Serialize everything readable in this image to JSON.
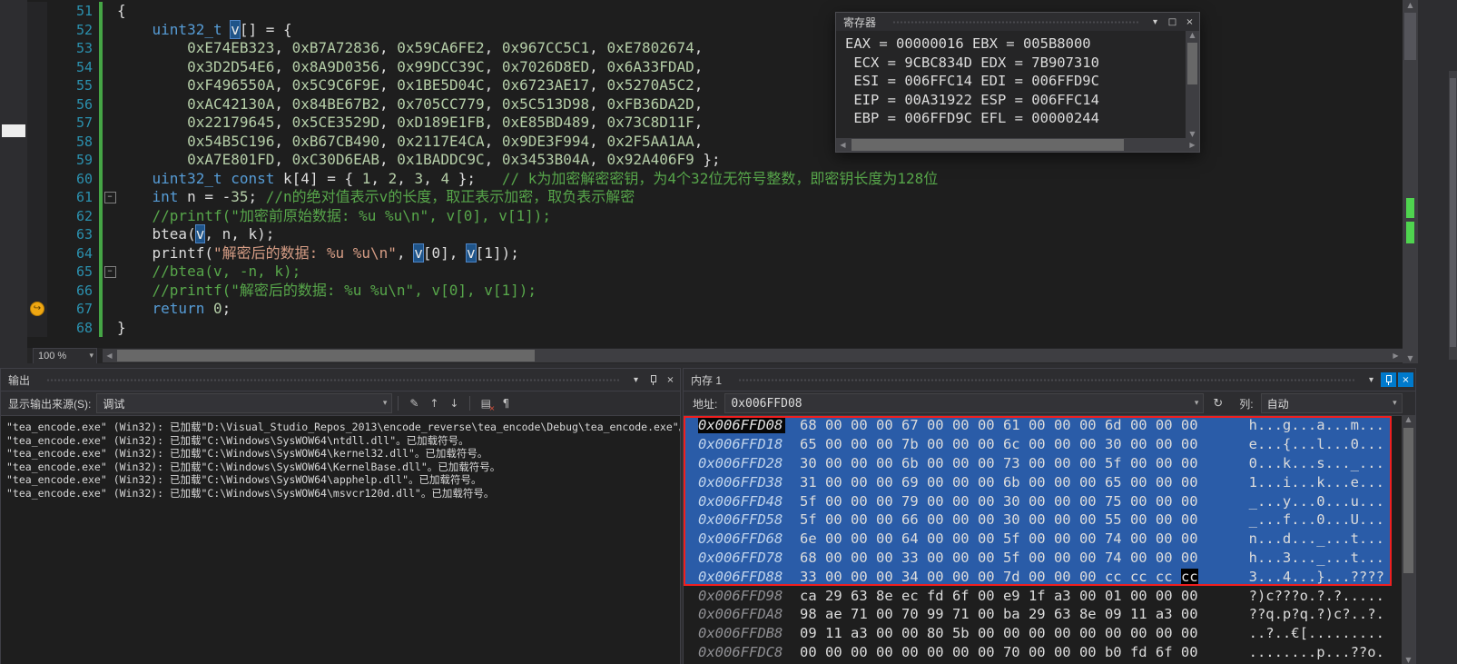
{
  "colors": {
    "selection_blue": "#2A5CA8",
    "annotation_border_red": "#F01F1F",
    "accent_blue": "#007ACC",
    "change_tracking_green": "#45A545",
    "keyword": "#569CD6",
    "number": "#B5CEA8",
    "comment": "#57A64A",
    "string": "#D69D85"
  },
  "icons": {
    "window_menu": "▾",
    "dropdown": "▾",
    "maximize": "□",
    "close": "×",
    "refresh": "↻",
    "scroll_up": "▲",
    "scroll_down": "▼",
    "scroll_left": "◀",
    "scroll_right": "▶",
    "fold_collapse": "−",
    "current_statement": "↪",
    "find_message": "✎",
    "prev_message": "↑",
    "next_message": "↓",
    "clear_all": "▤",
    "word_wrap": "¶"
  },
  "editor": {
    "zoom_level": "100 %",
    "lines": [
      {
        "n": "51",
        "seg": [
          [
            "p",
            "{"
          ]
        ]
      },
      {
        "n": "52",
        "seg": [
          [
            "p",
            "    "
          ],
          [
            "k",
            "uint32_t"
          ],
          [
            "p",
            " "
          ],
          [
            "h",
            "v"
          ],
          [
            "p",
            "[] = {"
          ]
        ]
      },
      {
        "n": "53",
        "seg": [
          [
            "p",
            "        "
          ],
          [
            "n",
            "0xE74EB323"
          ],
          [
            "p",
            ", "
          ],
          [
            "n",
            "0xB7A72836"
          ],
          [
            "p",
            ", "
          ],
          [
            "n",
            "0x59CA6FE2"
          ],
          [
            "p",
            ", "
          ],
          [
            "n",
            "0x967CC5C1"
          ],
          [
            "p",
            ", "
          ],
          [
            "n",
            "0xE7802674"
          ],
          [
            "p",
            ","
          ]
        ]
      },
      {
        "n": "54",
        "seg": [
          [
            "p",
            "        "
          ],
          [
            "n",
            "0x3D2D54E6"
          ],
          [
            "p",
            ", "
          ],
          [
            "n",
            "0x8A9D0356"
          ],
          [
            "p",
            ", "
          ],
          [
            "n",
            "0x99DCC39C"
          ],
          [
            "p",
            ", "
          ],
          [
            "n",
            "0x7026D8ED"
          ],
          [
            "p",
            ", "
          ],
          [
            "n",
            "0x6A33FDAD"
          ],
          [
            "p",
            ","
          ]
        ]
      },
      {
        "n": "55",
        "seg": [
          [
            "p",
            "        "
          ],
          [
            "n",
            "0xF496550A"
          ],
          [
            "p",
            ", "
          ],
          [
            "n",
            "0x5C9C6F9E"
          ],
          [
            "p",
            ", "
          ],
          [
            "n",
            "0x1BE5D04C"
          ],
          [
            "p",
            ", "
          ],
          [
            "n",
            "0x6723AE17"
          ],
          [
            "p",
            ", "
          ],
          [
            "n",
            "0x5270A5C2"
          ],
          [
            "p",
            ","
          ]
        ]
      },
      {
        "n": "56",
        "seg": [
          [
            "p",
            "        "
          ],
          [
            "n",
            "0xAC42130A"
          ],
          [
            "p",
            ", "
          ],
          [
            "n",
            "0x84BE67B2"
          ],
          [
            "p",
            ", "
          ],
          [
            "n",
            "0x705CC779"
          ],
          [
            "p",
            ", "
          ],
          [
            "n",
            "0x5C513D98"
          ],
          [
            "p",
            ", "
          ],
          [
            "n",
            "0xFB36DA2D"
          ],
          [
            "p",
            ","
          ]
        ]
      },
      {
        "n": "57",
        "seg": [
          [
            "p",
            "        "
          ],
          [
            "n",
            "0x22179645"
          ],
          [
            "p",
            ", "
          ],
          [
            "n",
            "0x5CE3529D"
          ],
          [
            "p",
            ", "
          ],
          [
            "n",
            "0xD189E1FB"
          ],
          [
            "p",
            ", "
          ],
          [
            "n",
            "0xE85BD489"
          ],
          [
            "p",
            ", "
          ],
          [
            "n",
            "0x73C8D11F"
          ],
          [
            "p",
            ","
          ]
        ]
      },
      {
        "n": "58",
        "seg": [
          [
            "p",
            "        "
          ],
          [
            "n",
            "0x54B5C196"
          ],
          [
            "p",
            ", "
          ],
          [
            "n",
            "0xB67CB490"
          ],
          [
            "p",
            ", "
          ],
          [
            "n",
            "0x2117E4CA"
          ],
          [
            "p",
            ", "
          ],
          [
            "n",
            "0x9DE3F994"
          ],
          [
            "p",
            ", "
          ],
          [
            "n",
            "0x2F5AA1AA"
          ],
          [
            "p",
            ","
          ]
        ]
      },
      {
        "n": "59",
        "seg": [
          [
            "p",
            "        "
          ],
          [
            "n",
            "0xA7E801FD"
          ],
          [
            "p",
            ", "
          ],
          [
            "n",
            "0xC30D6EAB"
          ],
          [
            "p",
            ", "
          ],
          [
            "n",
            "0x1BADDC9C"
          ],
          [
            "p",
            ", "
          ],
          [
            "n",
            "0x3453B04A"
          ],
          [
            "p",
            ", "
          ],
          [
            "n",
            "0x92A406F9"
          ],
          [
            "p",
            " };"
          ]
        ]
      },
      {
        "n": "60",
        "seg": [
          [
            "p",
            "    "
          ],
          [
            "k",
            "uint32_t"
          ],
          [
            "p",
            " "
          ],
          [
            "k",
            "const"
          ],
          [
            "p",
            " k[4] = { "
          ],
          [
            "n",
            "1"
          ],
          [
            "p",
            ", "
          ],
          [
            "n",
            "2"
          ],
          [
            "p",
            ", "
          ],
          [
            "n",
            "3"
          ],
          [
            "p",
            ", "
          ],
          [
            "n",
            "4"
          ],
          [
            "p",
            " };   "
          ],
          [
            "c",
            "// k为加密解密密钥，为4个32位无符号整数，即密钥长度为128位"
          ]
        ]
      },
      {
        "n": "61",
        "fold": true,
        "seg": [
          [
            "p",
            "    "
          ],
          [
            "k",
            "int"
          ],
          [
            "p",
            " n = -"
          ],
          [
            "n",
            "35"
          ],
          [
            "p",
            "; "
          ],
          [
            "c",
            "//n的绝对值表示v的长度，取正表示加密，取负表示解密"
          ]
        ]
      },
      {
        "n": "62",
        "seg": [
          [
            "p",
            "    "
          ],
          [
            "c",
            "//printf(\"加密前原始数据: %u %u\\n\", v[0], v[1]);"
          ]
        ]
      },
      {
        "n": "63",
        "seg": [
          [
            "p",
            "    btea("
          ],
          [
            "h",
            "v"
          ],
          [
            "p",
            ", n, k);"
          ]
        ]
      },
      {
        "n": "64",
        "seg": [
          [
            "p",
            "    printf("
          ],
          [
            "s",
            "\"解密后的数据: %u %u\\n\""
          ],
          [
            "p",
            ", "
          ],
          [
            "h",
            "v"
          ],
          [
            "p",
            "[0], "
          ],
          [
            "h",
            "v"
          ],
          [
            "p",
            "[1]);"
          ]
        ]
      },
      {
        "n": "65",
        "fold": true,
        "seg": [
          [
            "p",
            "    "
          ],
          [
            "c",
            "//btea(v, -n, k);"
          ]
        ]
      },
      {
        "n": "66",
        "seg": [
          [
            "p",
            "    "
          ],
          [
            "c",
            "//printf(\"解密后的数据: %u %u\\n\", v[0], v[1]);"
          ]
        ]
      },
      {
        "n": "67",
        "marker": "current",
        "seg": [
          [
            "p",
            "    "
          ],
          [
            "k",
            "return"
          ],
          [
            "p",
            " "
          ],
          [
            "n",
            "0"
          ],
          [
            "p",
            ";"
          ]
        ]
      },
      {
        "n": "68",
        "seg": [
          [
            "p",
            "}"
          ]
        ]
      }
    ]
  },
  "registers": {
    "title": "寄存器",
    "rows": [
      "EAX = 00000016 EBX = 005B8000",
      " ECX = 9CBC834D EDX = 7B907310",
      " ESI = 006FFC14 EDI = 006FFD9C",
      " EIP = 00A31922 ESP = 006FFC14",
      " EBP = 006FFD9C EFL = 00000244"
    ]
  },
  "output": {
    "title": "输出",
    "source_label": "显示输出来源(S):",
    "source_value": "调试",
    "lines": [
      "\"tea_encode.exe\" (Win32): 已加载\"D:\\Visual_Studio_Repos_2013\\encode_reverse\\tea_encode\\Debug\\tea_encode.exe\"。已加载",
      "\"tea_encode.exe\" (Win32): 已加载\"C:\\Windows\\SysWOW64\\ntdll.dll\"。已加载符号。",
      "\"tea_encode.exe\" (Win32): 已加载\"C:\\Windows\\SysWOW64\\kernel32.dll\"。已加载符号。",
      "\"tea_encode.exe\" (Win32): 已加载\"C:\\Windows\\SysWOW64\\KernelBase.dll\"。已加载符号。",
      "\"tea_encode.exe\" (Win32): 已加载\"C:\\Windows\\SysWOW64\\apphelp.dll\"。已加载符号。",
      "\"tea_encode.exe\" (Win32): 已加载\"C:\\Windows\\SysWOW64\\msvcr120d.dll\"。已加载符号。"
    ]
  },
  "memory": {
    "title": "内存 1",
    "address_label": "地址:",
    "address_value": "0x006FFD08",
    "columns_label": "列:",
    "columns_value": "自动",
    "rows": [
      {
        "addr": "0x006FFD08",
        "hex": "68 00 00 00 67 00 00 00 61 00 00 00 6d 00 00 00",
        "ascii": "h...g...a...m...",
        "selected": true,
        "anchor": true
      },
      {
        "addr": "0x006FFD18",
        "hex": "65 00 00 00 7b 00 00 00 6c 00 00 00 30 00 00 00",
        "ascii": "e...{...l...0...",
        "selected": true
      },
      {
        "addr": "0x006FFD28",
        "hex": "30 00 00 00 6b 00 00 00 73 00 00 00 5f 00 00 00",
        "ascii": "0...k...s..._...",
        "selected": true
      },
      {
        "addr": "0x006FFD38",
        "hex": "31 00 00 00 69 00 00 00 6b 00 00 00 65 00 00 00",
        "ascii": "1...i...k...e...",
        "selected": true
      },
      {
        "addr": "0x006FFD48",
        "hex": "5f 00 00 00 79 00 00 00 30 00 00 00 75 00 00 00",
        "ascii": "_...y...0...u...",
        "selected": true
      },
      {
        "addr": "0x006FFD58",
        "hex": "5f 00 00 00 66 00 00 00 30 00 00 00 55 00 00 00",
        "ascii": "_...f...0...U...",
        "selected": true
      },
      {
        "addr": "0x006FFD68",
        "hex": "6e 00 00 00 64 00 00 00 5f 00 00 00 74 00 00 00",
        "ascii": "n...d..._...t...",
        "selected": true
      },
      {
        "addr": "0x006FFD78",
        "hex": "68 00 00 00 33 00 00 00 5f 00 00 00 74 00 00 00",
        "ascii": "h...3..._...t...",
        "selected": true
      },
      {
        "addr": "0x006FFD88",
        "hex": "33 00 00 00 34 00 00 00 7d 00 00 00 cc cc cc ",
        "cursor_byte": "cc",
        "ascii": "3...4...}...????",
        "selected": true
      },
      {
        "addr": "0x006FFD98",
        "hex": "ca 29 63 8e ec fd 6f 00 e9 1f a3 00 01 00 00 00",
        "ascii": "?)c???o.?.?.....",
        "selected": false
      },
      {
        "addr": "0x006FFDA8",
        "hex": "98 ae 71 00 70 99 71 00 ba 29 63 8e 09 11 a3 00",
        "ascii": "??q.p?q.?)c?..?.",
        "selected": false
      },
      {
        "addr": "0x006FFDB8",
        "hex": "09 11 a3 00 00 80 5b 00 00 00 00 00 00 00 00 00",
        "ascii": "..?..€[.........",
        "selected": false
      },
      {
        "addr": "0x006FFDC8",
        "hex": "00 00 00 00 00 00 00 00 70 00 00 00 b0 fd 6f 00",
        "ascii": "........p...??o.",
        "selected": false
      }
    ]
  }
}
